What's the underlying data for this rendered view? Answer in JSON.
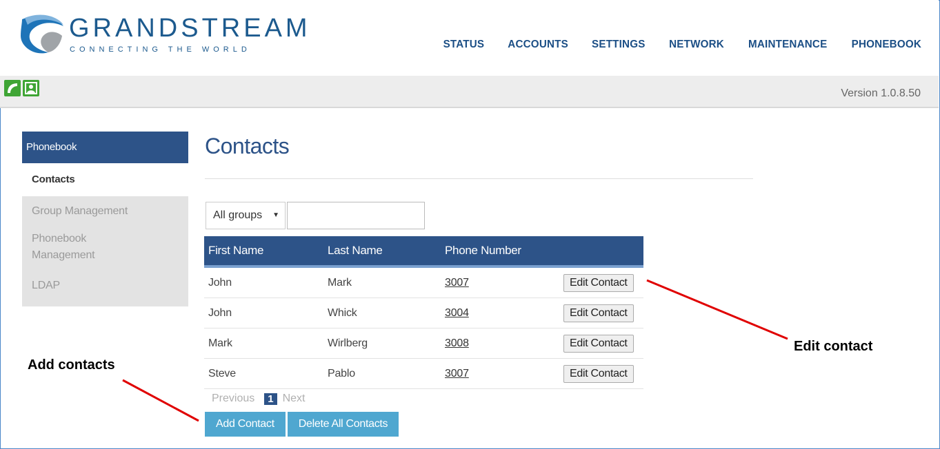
{
  "brand": {
    "name": "GRANDSTREAM",
    "tagline": "CONNECTING THE WORLD"
  },
  "nav": [
    {
      "label": "STATUS"
    },
    {
      "label": "ACCOUNTS"
    },
    {
      "label": "SETTINGS"
    },
    {
      "label": "NETWORK"
    },
    {
      "label": "MAINTENANCE"
    },
    {
      "label": "PHONEBOOK"
    }
  ],
  "toolbar": {
    "version": "Version 1.0.8.50",
    "icons": [
      "phone-icon",
      "contact-card-icon"
    ]
  },
  "sidebar": {
    "header": "Phonebook",
    "items": [
      {
        "label": "Contacts",
        "active": true
      },
      {
        "label": "Group Management"
      },
      {
        "label": "Phonebook Management"
      },
      {
        "label": "LDAP"
      }
    ]
  },
  "main": {
    "title": "Contacts",
    "filter": {
      "selected": "All groups",
      "search_value": ""
    },
    "table": {
      "columns": [
        "First Name",
        "Last Name",
        "Phone Number"
      ],
      "rows": [
        {
          "first": "John",
          "last": "Mark",
          "phone": "3007",
          "action": "Edit Contact"
        },
        {
          "first": "John",
          "last": "Whick",
          "phone": "3004",
          "action": "Edit Contact"
        },
        {
          "first": "Mark",
          "last": "Wirlberg",
          "phone": "3008",
          "action": "Edit Contact"
        },
        {
          "first": "Steve",
          "last": "Pablo",
          "phone": "3007",
          "action": "Edit Contact"
        }
      ]
    },
    "pagination": {
      "previous": "Previous",
      "current": "1",
      "next": "Next"
    },
    "buttons": {
      "add": "Add Contact",
      "delete_all": "Delete All Contacts"
    }
  },
  "annotations": {
    "edit": "Edit contact",
    "add": "Add contacts",
    "arrow_color": "#e00000"
  },
  "colors": {
    "nav_blue": "#1c4f86",
    "header_blue": "#2d5388",
    "button_blue": "#4fa7d0",
    "icon_green": "#3fa535"
  }
}
